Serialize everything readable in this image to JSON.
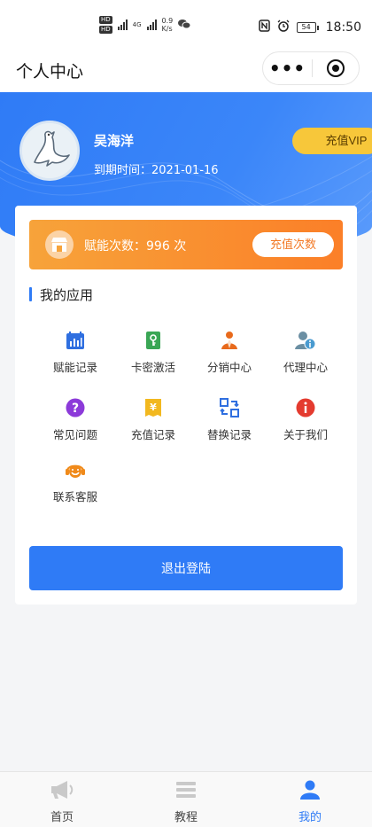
{
  "status_bar": {
    "net_speed": "0.9",
    "net_unit": "K/s",
    "battery": "54",
    "time": "18:50",
    "hd1": "HD",
    "hd2": "HD",
    "net_type": "4G"
  },
  "nav": {
    "title": "个人中心",
    "more_glyph": "•••"
  },
  "profile": {
    "name": "吴海洋",
    "expire_label": "到期时间：",
    "expire_date": "2021-01-16",
    "vip_button": "充值VIP"
  },
  "count": {
    "label": "赋能次数：",
    "value": "996",
    "unit": "次",
    "button": "充值次数"
  },
  "section": {
    "title": "我的应用"
  },
  "apps": [
    {
      "label": "赋能记录",
      "icon": "calendar-chart-icon",
      "color": "#2f6fe0"
    },
    {
      "label": "卡密激活",
      "icon": "key-icon",
      "color": "#3aa655"
    },
    {
      "label": "分销中心",
      "icon": "distribution-icon",
      "color": "#e86a1c"
    },
    {
      "label": "代理中心",
      "icon": "agent-icon",
      "color": "#4a9bd0"
    },
    {
      "label": "常见问题",
      "icon": "question-icon",
      "color": "#8c3ad9"
    },
    {
      "label": "充值记录",
      "icon": "yen-icon",
      "color": "#f2b81f"
    },
    {
      "label": "替换记录",
      "icon": "swap-icon",
      "color": "#2f6fe0"
    },
    {
      "label": "关于我们",
      "icon": "info-icon",
      "color": "#e43b2f"
    },
    {
      "label": "联系客服",
      "icon": "headset-icon",
      "color": "#f08a1a"
    }
  ],
  "logout_button": "退出登陆",
  "tabs": [
    {
      "label": "首页",
      "icon": "megaphone-icon"
    },
    {
      "label": "教程",
      "icon": "menu-icon"
    },
    {
      "label": "我的",
      "icon": "person-icon"
    }
  ],
  "colors": {
    "primary": "#2f7bf6",
    "vip": "#f7c73a",
    "orange": "#fb7f28"
  }
}
